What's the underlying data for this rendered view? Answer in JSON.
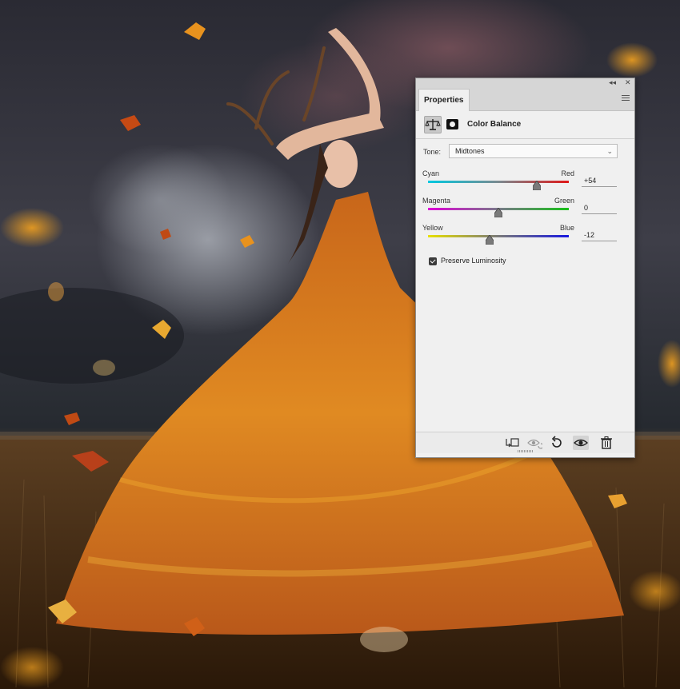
{
  "panel": {
    "tab_label": "Properties",
    "title": "Color Balance",
    "title_icon": "balance-scale-icon",
    "mask_icon": "layer-mask-icon",
    "tone": {
      "label": "Tone:",
      "value": "Midtones"
    },
    "sliders": [
      {
        "left": "Cyan",
        "right": "Red",
        "value": "+54",
        "level": 54,
        "colors": [
          "#00c8e0",
          "#e01818"
        ]
      },
      {
        "left": "Magenta",
        "right": "Green",
        "value": "0",
        "level": 0,
        "colors": [
          "#e000d8",
          "#18c018"
        ]
      },
      {
        "left": "Yellow",
        "right": "Blue",
        "value": "-12",
        "level": -12,
        "colors": [
          "#e8e000",
          "#1818e0"
        ]
      }
    ],
    "preserve_luminosity": {
      "label": "Preserve Luminosity",
      "checked": true
    },
    "footer_icons": [
      "clip-to-layer-icon",
      "view-previous-state-icon",
      "reset-icon",
      "visibility-eye-icon",
      "trash-icon"
    ]
  },
  "colors": {
    "panel_bg": "#f0f0f0",
    "sky": "#3a3842",
    "grass": "#5a3a1c",
    "leaves": "#d9821e"
  }
}
